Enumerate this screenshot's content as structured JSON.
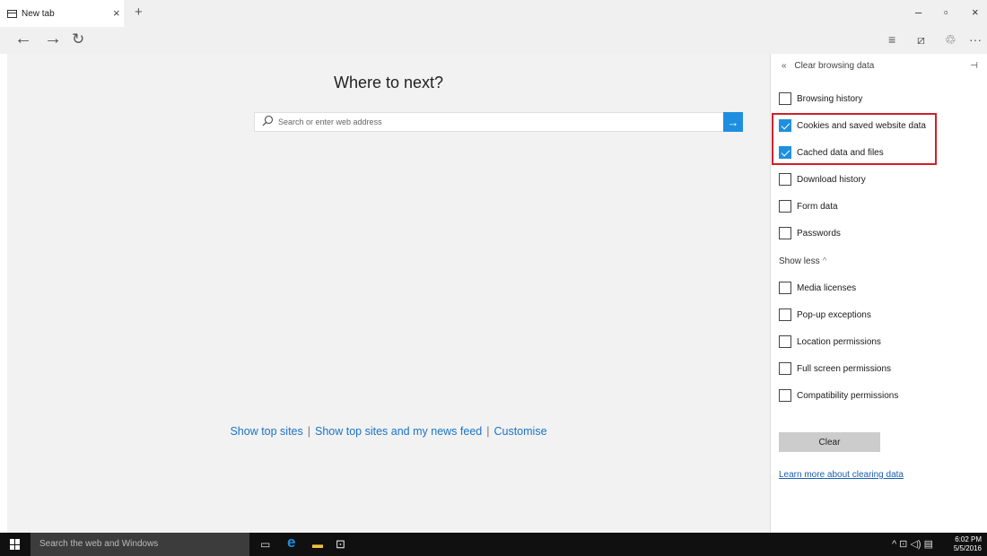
{
  "browser": {
    "tab": {
      "title": "New tab",
      "close_glyph": "×",
      "icon": "tab-page-icon"
    },
    "new_tab_glyph": "+",
    "window_controls": [
      "–",
      "▫",
      "×"
    ],
    "nav": {
      "back": "←",
      "forward": "→",
      "refresh": "↻"
    },
    "toolbar_icons": [
      "hub-icon",
      "web-note-icon",
      "share-icon",
      "more-icon"
    ],
    "toolbar_glyphs": [
      "≡",
      "⧄",
      "♲",
      "···"
    ]
  },
  "newtab": {
    "heading": "Where to next?",
    "search_placeholder": "Search or enter web address",
    "go_glyph": "→",
    "links": {
      "show_top_sites": "Show top sites",
      "show_top_sites_news": "Show top sites and my news feed",
      "customise": "Customise",
      "separator": "|"
    }
  },
  "pane": {
    "title": "Clear browsing data",
    "back_glyph": "«",
    "pin_glyph": "⊣",
    "options": [
      {
        "label": "Browsing history",
        "checked": false
      },
      {
        "label": "Cookies and saved website data",
        "checked": true
      },
      {
        "label": "Cached data and files",
        "checked": true
      },
      {
        "label": "Download history",
        "checked": false
      },
      {
        "label": "Form data",
        "checked": false
      },
      {
        "label": "Passwords",
        "checked": false
      }
    ],
    "show_less": "Show less",
    "show_less_glyph": "^",
    "more_options": [
      {
        "label": "Media licenses",
        "checked": false
      },
      {
        "label": "Pop-up exceptions",
        "checked": false
      },
      {
        "label": "Location permissions",
        "checked": false
      },
      {
        "label": "Full screen permissions",
        "checked": false
      },
      {
        "label": "Compatibility permissions",
        "checked": false
      }
    ],
    "clear_label": "Clear",
    "learn_more": "Learn more about clearing data",
    "highlight_color": "#d0202a"
  },
  "taskbar": {
    "search_placeholder": "Search the web and Windows",
    "tray_glyphs": "^ ⊡ ◁) ▤",
    "time": "6:02 PM",
    "date": "5/5/2016"
  },
  "colors": {
    "accent": "#1e8fe0",
    "link": "#1a73c6"
  }
}
